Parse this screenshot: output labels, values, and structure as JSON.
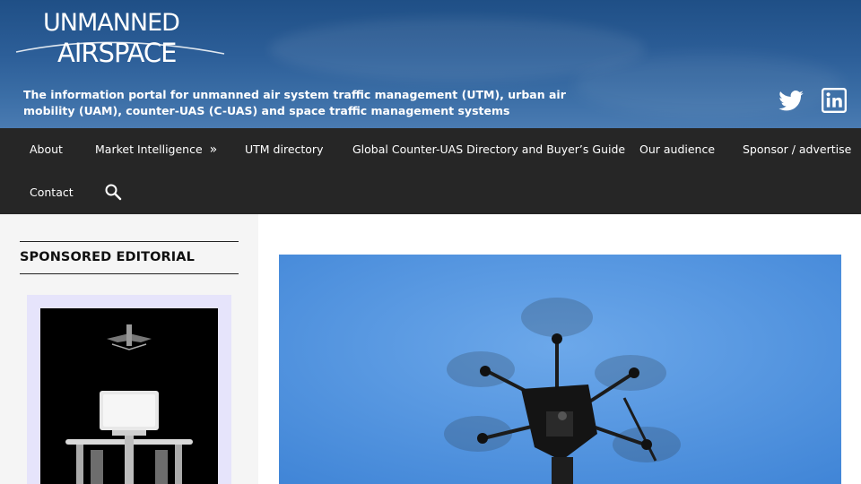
{
  "brand": {
    "logo_line1": "UNMANNED",
    "logo_line2": "AIRSPACE",
    "tagline": "The information portal for unmanned air system traffic management (UTM), urban air mobility (UAM), counter-UAS (C-UAS) and space traffic management systems"
  },
  "social": {
    "twitter_icon": "twitter-icon",
    "linkedin_icon": "linkedin-icon"
  },
  "nav": {
    "items": [
      {
        "label": "About"
      },
      {
        "label": "Market Intelligence",
        "arrow": "»"
      },
      {
        "label": "UTM directory"
      },
      {
        "label": "Global Counter-UAS Directory and Buyer’s Guide"
      },
      {
        "label": "Our audience"
      },
      {
        "label": "Sponsor / advertise"
      },
      {
        "label": "Contact"
      }
    ],
    "search_icon": "search-icon"
  },
  "sidebar": {
    "title": "SPONSORED EDITORIAL"
  },
  "colors": {
    "header_bg": "#2d5f99",
    "nav_bg": "#262626",
    "sidebar_bg": "#f5f5f5",
    "ad_frame": "#e6e4fb",
    "sky": "#5a9ae0"
  }
}
